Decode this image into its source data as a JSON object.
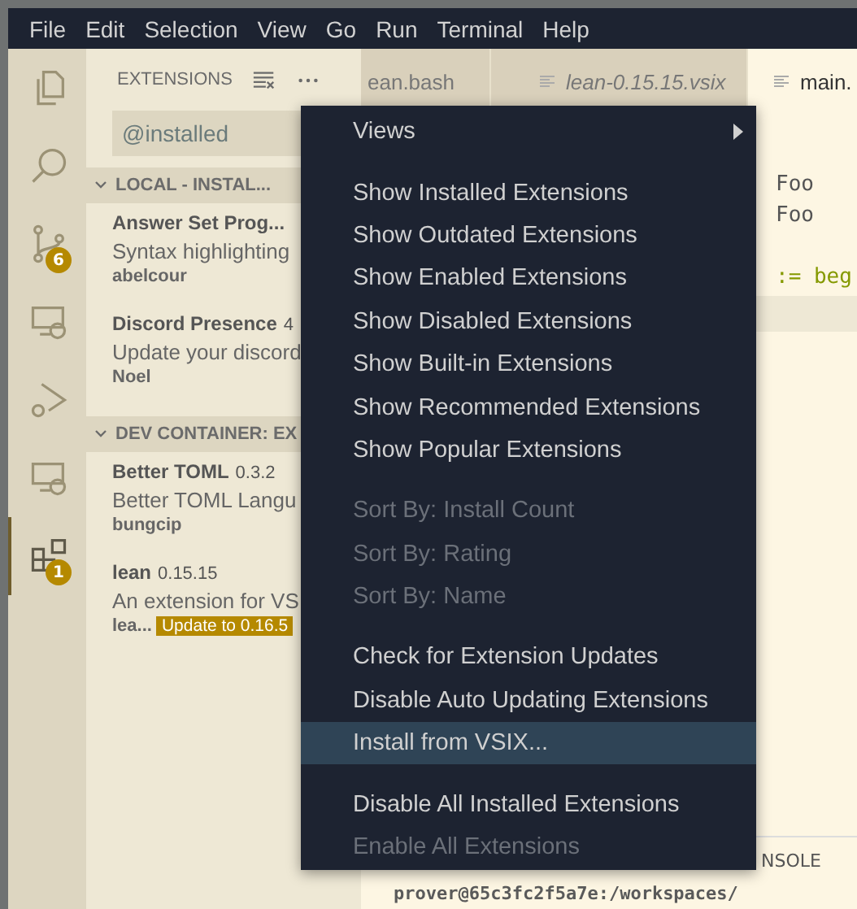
{
  "menu_bar": [
    "File",
    "Edit",
    "Selection",
    "View",
    "Go",
    "Run",
    "Terminal",
    "Help"
  ],
  "activity_bar": [
    {
      "kind": "files",
      "selected": false
    },
    {
      "kind": "search",
      "selected": false
    },
    {
      "kind": "source-control",
      "selected": false,
      "badge": "6"
    },
    {
      "kind": "remote",
      "selected": false
    },
    {
      "kind": "debug",
      "selected": false
    },
    {
      "kind": "remote",
      "selected": false
    },
    {
      "kind": "extensions",
      "selected": true,
      "badge": "1"
    }
  ],
  "sidebar": {
    "title": "EXTENSIONS",
    "search": {
      "value": "@installed"
    },
    "sections": [
      {
        "title": "LOCAL - INSTAL...",
        "items": [
          {
            "name": "Answer Set Prog...",
            "description": "Syntax highlighting",
            "publisher": "abelcour"
          },
          {
            "name": "Discord Presence",
            "version": "4",
            "description": "Update your discord",
            "publisher": "Noel"
          }
        ]
      },
      {
        "title": "DEV CONTAINER: EX",
        "items": [
          {
            "name": "Better TOML",
            "version": "0.3.2",
            "description": "Better TOML Langu",
            "publisher": "bungcip"
          },
          {
            "name": "lean",
            "version": "0.15.15",
            "description": "An extension for VS",
            "publisher": "lea...",
            "update": "Update to 0.16.5"
          }
        ]
      }
    ]
  },
  "editor_tabs": [
    {
      "label": "ean.bash",
      "italic": false,
      "selected": false
    },
    {
      "label": "lean-0.15.15.vsix",
      "italic": true,
      "selected": false
    },
    {
      "label": "main.",
      "italic": false,
      "selected": true
    }
  ],
  "editor_lines": [
    {
      "text": "Foo",
      "kind": "plain"
    },
    {
      "text": "Foo",
      "kind": "plain"
    },
    {
      "kind": "blank"
    },
    {
      "text": ":= beg",
      "kind": "code"
    }
  ],
  "panel": {
    "tab": "NSOLE",
    "terminal": "prover@65c3fc2f5a7e:/workspaces/"
  },
  "context_menu": [
    {
      "kind": "item",
      "label": "Views",
      "submenu": true,
      "disabled": false,
      "selected": false
    },
    {
      "kind": "separator"
    },
    {
      "kind": "item",
      "label": "Show Installed Extensions",
      "submenu": false,
      "disabled": false,
      "selected": false
    },
    {
      "kind": "item",
      "label": "Show Outdated Extensions",
      "submenu": false,
      "disabled": false,
      "selected": false
    },
    {
      "kind": "item",
      "label": "Show Enabled Extensions",
      "submenu": false,
      "disabled": false,
      "selected": false
    },
    {
      "kind": "item",
      "label": "Show Disabled Extensions",
      "submenu": false,
      "disabled": false,
      "selected": false
    },
    {
      "kind": "item",
      "label": "Show Built-in Extensions",
      "submenu": false,
      "disabled": false,
      "selected": false
    },
    {
      "kind": "item",
      "label": "Show Recommended Extensions",
      "submenu": false,
      "disabled": false,
      "selected": false
    },
    {
      "kind": "item",
      "label": "Show Popular Extensions",
      "submenu": false,
      "disabled": false,
      "selected": false
    },
    {
      "kind": "separator"
    },
    {
      "kind": "item",
      "label": "Sort By: Install Count",
      "submenu": false,
      "disabled": true,
      "selected": false
    },
    {
      "kind": "item",
      "label": "Sort By: Rating",
      "submenu": false,
      "disabled": true,
      "selected": false
    },
    {
      "kind": "item",
      "label": "Sort By: Name",
      "submenu": false,
      "disabled": true,
      "selected": false
    },
    {
      "kind": "separator"
    },
    {
      "kind": "item",
      "label": "Check for Extension Updates",
      "submenu": false,
      "disabled": false,
      "selected": false
    },
    {
      "kind": "item",
      "label": "Disable Auto Updating Extensions",
      "submenu": false,
      "disabled": false,
      "selected": false
    },
    {
      "kind": "item",
      "label": "Install from VSIX...",
      "submenu": false,
      "disabled": false,
      "selected": true
    },
    {
      "kind": "separator"
    },
    {
      "kind": "item",
      "label": "Disable All Installed Extensions",
      "submenu": false,
      "disabled": false,
      "selected": false
    },
    {
      "kind": "item",
      "label": "Enable All Extensions",
      "submenu": false,
      "disabled": true,
      "selected": false
    }
  ]
}
